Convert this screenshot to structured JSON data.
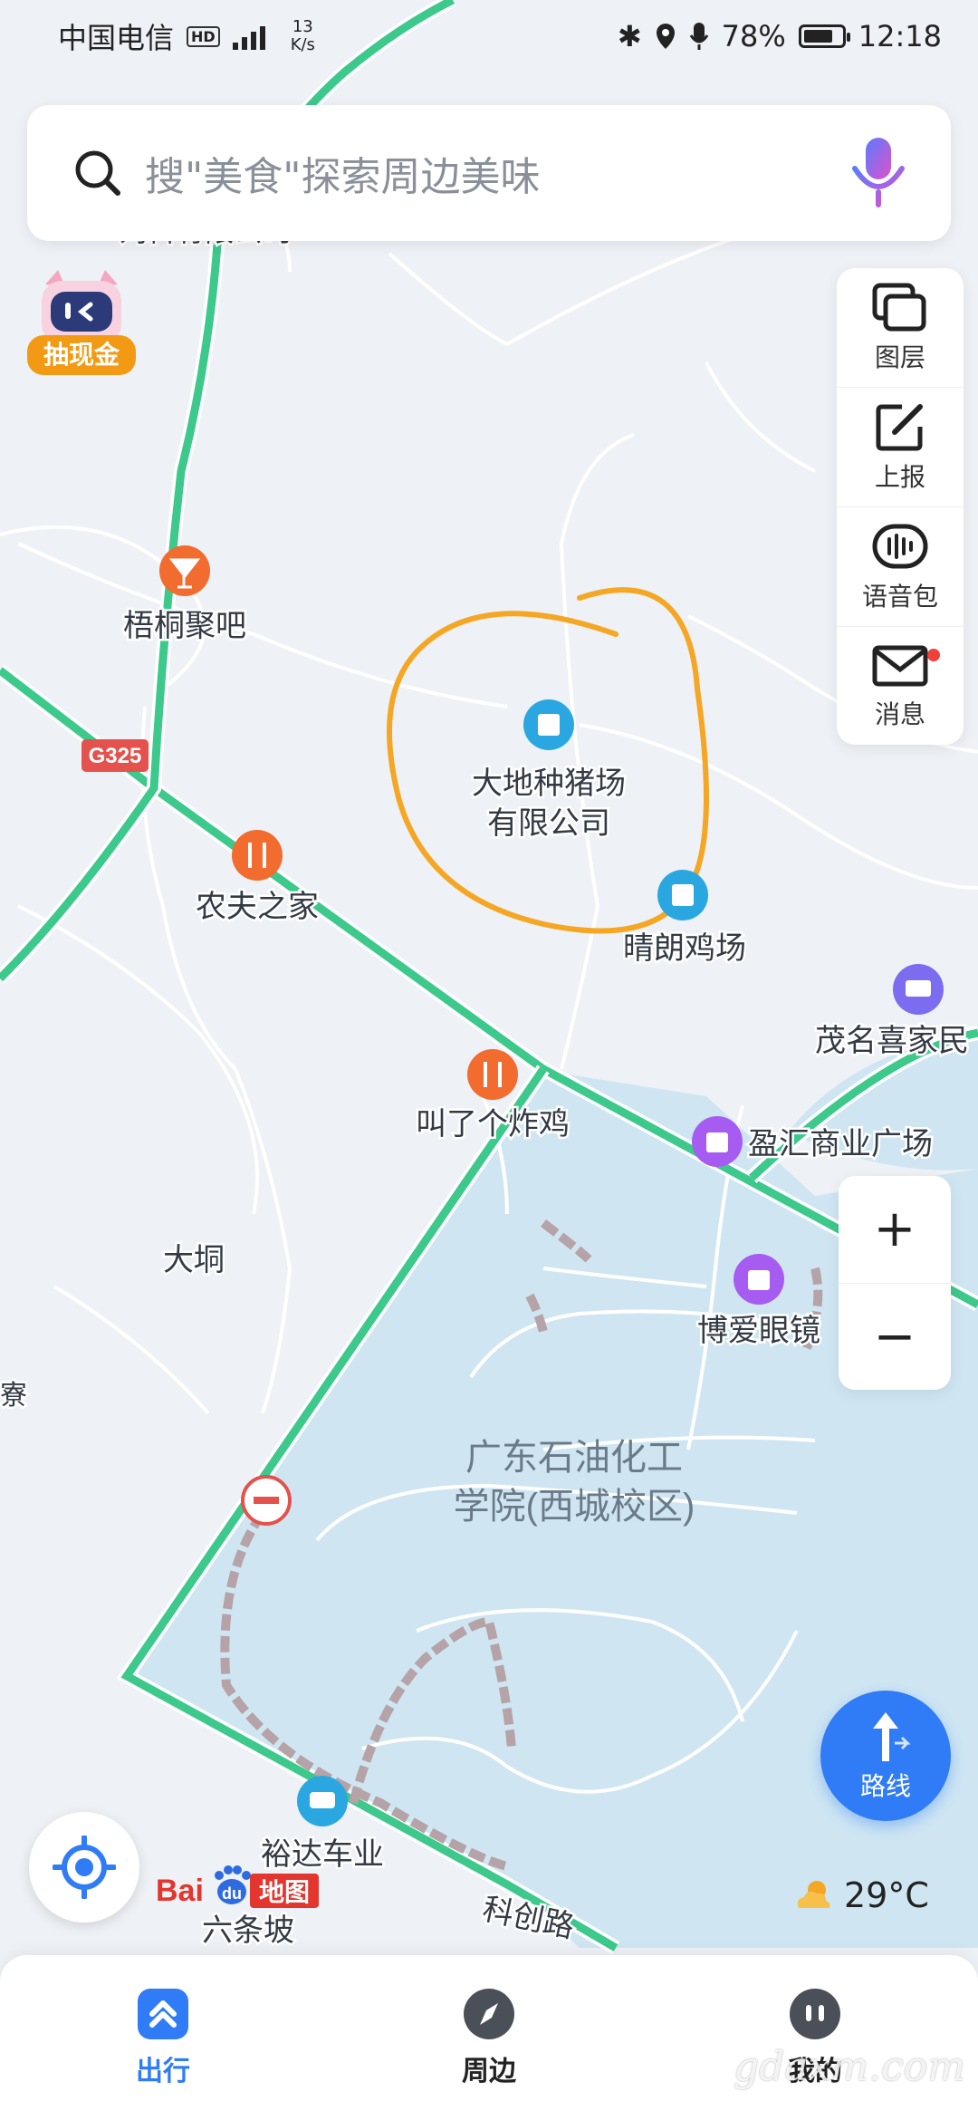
{
  "status_bar": {
    "carrier": "中国电信",
    "hd": "HD",
    "speed_value": "13",
    "speed_unit": "K/s",
    "battery": "78%",
    "battery_level": 0.78,
    "time": "12:18"
  },
  "search": {
    "placeholder": "搜\"美食\"探索周边美味"
  },
  "cash_badge": {
    "label": "抽现金"
  },
  "tools": {
    "layers": "图层",
    "report": "上报",
    "voice_pack": "语音包",
    "messages": "消息"
  },
  "map": {
    "road_badge": "G325",
    "cut_label_top": "饲料有限公司",
    "pois": {
      "wutong": "梧桐聚吧",
      "dadi_line1": "大地种猪场",
      "dadi_line2": "有限公司",
      "qinglang": "晴朗鸡场",
      "nongfu": "农夫之家",
      "maoming": "茂名喜家民",
      "jiaole": "叫了个炸鸡",
      "yinghui": "盈汇商业广场",
      "datong": "大垌",
      "boai": "博爱眼镜",
      "campus_line1": "广东石油化工",
      "campus_line2": "学院(西城校区)",
      "yuda": "裕达车业",
      "liutiaopo": "六条坡",
      "kechuang": "科创路",
      "edge_left": "寮"
    },
    "colors": {
      "highway": "#3cc98b",
      "campus": "#cfe6f2",
      "annotation_circle": "#f5a623",
      "congestion": "#b5a3a7"
    }
  },
  "zoom": {
    "in": "+",
    "out": "−"
  },
  "route_button": {
    "label": "路线"
  },
  "weather": {
    "temp": "29°C"
  },
  "baidu": {
    "bai": "Bai",
    "du": "du",
    "ditu": "地图"
  },
  "tabs": [
    {
      "label": "出行",
      "active": true
    },
    {
      "label": "周边",
      "active": false
    },
    {
      "label": "我的",
      "active": false
    }
  ],
  "watermark": "gdaxm.com"
}
